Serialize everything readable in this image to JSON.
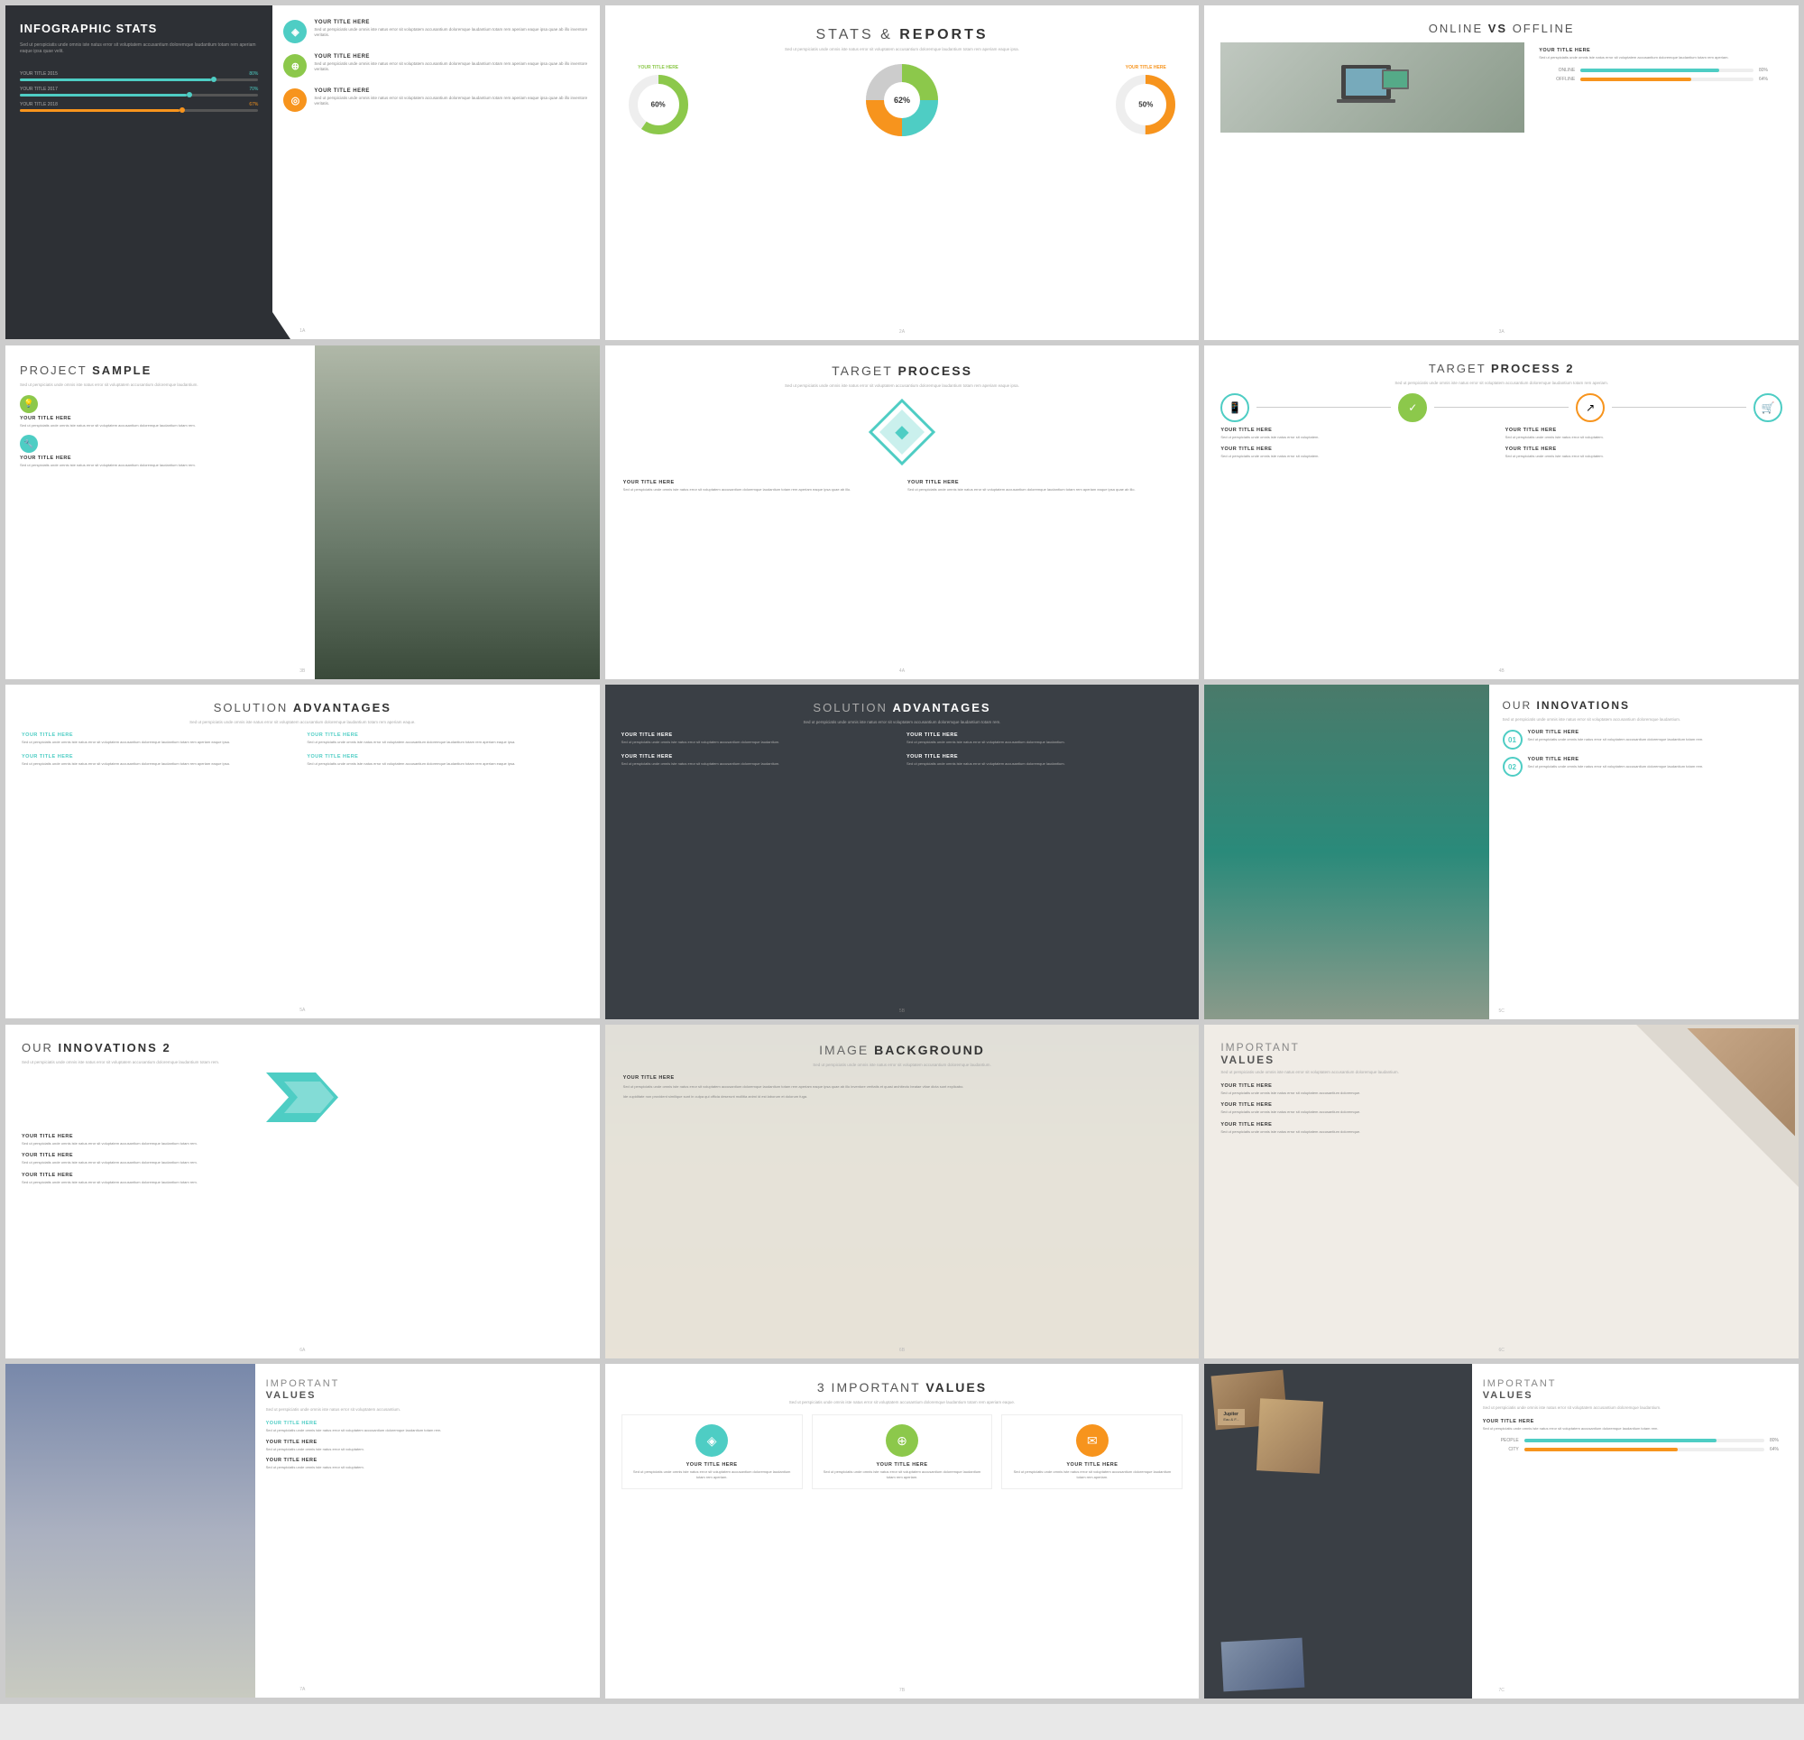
{
  "slides": [
    {
      "id": 1,
      "type": "infographic-stats",
      "title": "INFOGRAPHIC STATS",
      "body_text": "Sed ut perspiciatis unde omnis iste natus error sit voluptatem accusantium doloremque laudantium totam rem aperiam eaque ipsa quae velit.",
      "bars": [
        {
          "label": "YOUR TITLE 2015",
          "value": 80,
          "color": "#4ecdc4"
        },
        {
          "label": "YOUR TITLE 2017",
          "value": 70,
          "color": "#4ecdc4"
        },
        {
          "label": "YOUR TITLE 2018",
          "value": 67,
          "color": "#f7941d"
        }
      ],
      "items": [
        {
          "icon": "◈",
          "color": "#4ecdc4",
          "title": "YOUR TITLE HERE",
          "text": "Sed ut perspiciatis unde omnis iste natus error sit voluptatem accusantium doloremque laudantium totam rem aperiam eaque ipsa quae ab illo inventore."
        },
        {
          "icon": "⊕",
          "color": "#8cc84b",
          "title": "YOUR TITLE HERE",
          "text": "Sed ut perspiciatis unde omnis iste natus error sit voluptatem accusantium doloremque laudantium totam rem aperiam eaque ipsa quae ab illo inventore."
        },
        {
          "icon": "◎",
          "color": "#f7941d",
          "title": "YOUR TITLE HERE",
          "text": "Sed ut perspiciatis unde omnis iste natus error sit voluptatem accusantium doloremque laudantium totam rem aperiam eaque ipsa quae ab illo inventore."
        }
      ],
      "page": "1A"
    },
    {
      "id": 2,
      "type": "stats-reports",
      "title": "STATS & REPORTS",
      "title_bold": "REPORTS",
      "subtitle": "Sed ut perspiciatis unde omnis iste natus error sit voluptatem accusantium doloremque laudantium.",
      "chart_percent": "62%",
      "items": [
        {
          "color": "#8cc84b",
          "title": "YOUR TITLE HERE"
        },
        {
          "color": "#f7941d",
          "title": "YOUR TITLE HERE"
        }
      ],
      "page": "2A"
    },
    {
      "id": 3,
      "type": "online-vs-offline",
      "title": "ONLINE VS OFFLINE",
      "bars": [
        {
          "label": "ONLINE",
          "value": 80,
          "color": "#4ecdc4"
        },
        {
          "label": "OFFLINE",
          "value": 64,
          "color": "#f7941d"
        }
      ],
      "item_title": "YOUR TITLE HERE",
      "item_text": "Sed ut perspiciatis unde omnis iste natus error sit voluptatem accusantium doloremque laudantium.",
      "page": "3A"
    },
    {
      "id": 4,
      "type": "project-sample",
      "title": "PROJECT SAMPLE",
      "subtitle": "Sed ut perspiciatis unde omnis iste natus error sit voluptatem accusantium doloremque laudantium.",
      "items": [
        {
          "icon": "💡",
          "color": "#8cc84b",
          "title": "YOUR TITLE HERE",
          "text": "Sed ut perspiciatis unde omnis iste natus error sit voluptatem doloremque laudantium."
        },
        {
          "icon": "🔧",
          "color": "#4ecdc4",
          "title": "YOUR TITLE HERE",
          "text": "Sed ut perspiciatis unde omnis iste natus error sit voluptatem doloremque laudantium."
        }
      ],
      "page": "3B"
    },
    {
      "id": 5,
      "type": "target-process",
      "title": "TARGET PROCESS",
      "subtitle": "Sed ut perspiciatis unde omnis iste natus error sit voluptatem accusantium doloremque laudantium totam rem aperiam.",
      "items": [
        {
          "title": "YOUR TITLE HERE",
          "text": "Sed ut perspiciatis unde omnis iste natus error sit voluptatem accusantium doloremque laudantium totam rem aperiam eaque ipsa."
        },
        {
          "title": "YOUR TITLE HERE",
          "text": "Sed ut perspiciatis unde omnis iste natus error sit voluptatem accusantium doloremque laudantium totam rem aperiam eaque ipsa."
        }
      ],
      "page": "4A"
    },
    {
      "id": 6,
      "type": "target-process-2",
      "title": "TARGET PROCESS 2",
      "subtitle": "Sed ut perspiciatis unde omnis iste natus error sit voluptatem accusantium doloremque laudantium.",
      "items": [
        {
          "icon": "📱",
          "color": "#4ecdc4",
          "title": "YOUR TITLE HERE",
          "text": "Sed ut perspiciatis unde omnis iste natus."
        },
        {
          "icon": "✓",
          "color": "#8cc84b",
          "title": "YOUR TITLE HERE",
          "text": "Sed ut perspiciatis unde omnis iste natus."
        },
        {
          "icon": "↗",
          "color": "#f7941d",
          "title": "YOUR TITLE HERE",
          "text": "Sed ut perspiciatis unde omnis iste natus."
        },
        {
          "icon": "🛒",
          "color": "#4ecdc4",
          "title": "YOUR TITLE HERE",
          "text": "Sed ut perspiciatis unde omnis iste natus."
        }
      ],
      "page": "4B"
    },
    {
      "id": 7,
      "type": "solution-advantages-light",
      "title": "SOLUTION ADVANTAGES",
      "subtitle": "Sed ut perspiciatis unde omnis iste natus error sit voluptatem accusantium doloremque laudantium totam rem aperiam eaque.",
      "items": [
        {
          "title": "YOUR TITLE HERE",
          "text": "Sed ut perspiciatis unde omnis iste natus error sit voluptatem accusantium doloremque laudantium totam rem."
        },
        {
          "title": "YOUR TITLE HERE",
          "text": "Sed ut perspiciatis unde omnis iste natus error sit voluptatem accusantium doloremque laudantium totam rem."
        },
        {
          "title": "YOUR TITLE HERE",
          "text": "Sed ut perspiciatis unde omnis iste natus error sit voluptatem accusantium doloremque laudantium totam rem."
        },
        {
          "title": "YOUR TITLE HERE",
          "text": "Sed ut perspiciatis unde omnis iste natus error sit voluptatem accusantium doloremque laudantium totam rem."
        }
      ],
      "page": "5A"
    },
    {
      "id": 8,
      "type": "solution-advantages-dark",
      "title": "SOLUTION ADVANTAGES",
      "subtitle": "Sed ut perspiciatis unde omnis iste natus error sit voluptatem accusantium doloremque laudantium totam rem.",
      "items": [
        {
          "title": "YOUR TITLE HERE",
          "text": "Sed ut perspiciatis unde omnis iste natus error sit voluptatem accusantium doloremque laudantium."
        },
        {
          "title": "YOUR TITLE HERE",
          "text": "Sed ut perspiciatis unde omnis iste natus error sit voluptatem accusantium doloremque laudantium."
        },
        {
          "title": "YOUR TITLE HERE",
          "text": "Sed ut perspiciatis unde omnis iste natus error sit voluptatem accusantium doloremque laudantium."
        }
      ],
      "page": "5B"
    },
    {
      "id": 9,
      "type": "our-innovations",
      "title": "OUR INNOVATIONS",
      "subtitle": "Sed ut perspiciatis unde omnis iste natus error sit voluptatem accusantium doloremque laudantium.",
      "items": [
        {
          "num": "01",
          "title": "YOUR TITLE HERE",
          "text": "Sed ut perspiciatis unde omnis iste natus error sit voluptatem accusantium doloremque."
        },
        {
          "num": "02",
          "title": "YOUR TITLE HERE",
          "text": "Sed ut perspiciatis unde omnis iste natus error sit voluptatem accusantium doloremque."
        }
      ],
      "page": "5C"
    },
    {
      "id": 10,
      "type": "our-innovations-2",
      "title": "OUR INNOVATIONS 2",
      "subtitle": "Sed ut perspiciatis unde omnis iste natus error sit voluptatem accusantium doloremque laudantium totam.",
      "items": [
        {
          "title": "YOUR TITLE HERE",
          "text": "Sed ut perspiciatis unde omnis iste natus error sit voluptatem accusantium doloremque."
        },
        {
          "title": "YOUR TITLE HERE",
          "text": "Sed ut perspiciatis unde omnis iste natus error sit voluptatem accusantium doloremque."
        },
        {
          "title": "YOUR TITLE HERE",
          "text": "Sed ut perspiciatis unde omnis iste natus error sit voluptatem accusantium doloremque."
        }
      ],
      "page": "6A"
    },
    {
      "id": 11,
      "type": "image-background",
      "title": "IMAGE BACKGROUND",
      "subtitle": "Sed ut perspiciatis unde omnis iste natus error sit voluptatem accusantium doloremque laudantium.",
      "item_title": "YOUR TITLE HERE",
      "item_text": "Sed ut perspiciatis unde omnis iste natus error sit voluptatem accusantium doloremque laudantium totam rem aperiam eaque ipsa quae ab illo inventore.",
      "page": "6B"
    },
    {
      "id": 12,
      "type": "important-values-1",
      "title": "IMPORTANT VALUES",
      "subtitle": "Sed ut perspiciatis unde omnis iste natus error sit voluptatem accusantium doloremque laudantium.",
      "items": [
        {
          "title": "YOUR TITLE HERE",
          "text": "Sed ut perspiciatis unde omnis iste natus."
        },
        {
          "title": "YOUR TITLE HERE",
          "text": "Sed ut perspiciatis unde omnis iste natus."
        },
        {
          "title": "YOUR TITLE HERE",
          "text": "Sed ut perspiciatis unde omnis iste natus."
        }
      ],
      "page": "6C"
    },
    {
      "id": 13,
      "type": "important-values-2",
      "title": "IMPORTANT VALUES",
      "subtitle": "Sed ut perspiciatis unde omnis iste natus error sit voluptatem accusantium.",
      "items": [
        {
          "title": "YOUR TITLE HERE",
          "text": "Sed ut perspiciatis unde omnis iste natus."
        },
        {
          "title": "YOUR TITLE HERE",
          "text": "Sed ut perspiciatis unde omnis iste natus."
        }
      ],
      "page": "7A"
    },
    {
      "id": 14,
      "type": "3-important-values",
      "title": "3 IMPORTANT VALUES",
      "subtitle": "Sed ut perspiciatis unde omnis iste natus error sit voluptatem accusantium doloremque laudantium totam rem.",
      "items": [
        {
          "icon": "◈",
          "color": "#4ecdc4",
          "title": "YOUR TITLE HERE",
          "text": "Sed ut perspiciatis unde omnis iste natus error sit voluptatem accusantium doloremque laudantium."
        },
        {
          "icon": "⊕",
          "color": "#8cc84b",
          "title": "YOUR TITLE HERE",
          "text": "Sed ut perspiciatis unde omnis iste natus error sit voluptatem accusantium doloremque laudantium."
        },
        {
          "icon": "✉",
          "color": "#f7941d",
          "title": "YOUR TITLE HERE",
          "text": "Sed ut perspiciatis unde omnis iste natus error sit voluptatem accusantium doloremque laudantium."
        }
      ],
      "page": "7B"
    },
    {
      "id": 15,
      "type": "important-values-3",
      "title": "IMPORTANT VALUES",
      "subtitle": "Sed ut perspiciatis unde omnis iste natus error sit voluptatem accusantium doloremque.",
      "bars": [
        {
          "label": "PEOPLE",
          "value": 80,
          "color": "#4ecdc4"
        },
        {
          "label": "CITY",
          "value": 64,
          "color": "#f7941d"
        }
      ],
      "item_title": "YOUR TITLE HERE",
      "item_text": "Sed ut perspiciatis unde omnis iste natus error sit voluptatem accusantium doloremque laudantium.",
      "page": "7C"
    }
  ]
}
